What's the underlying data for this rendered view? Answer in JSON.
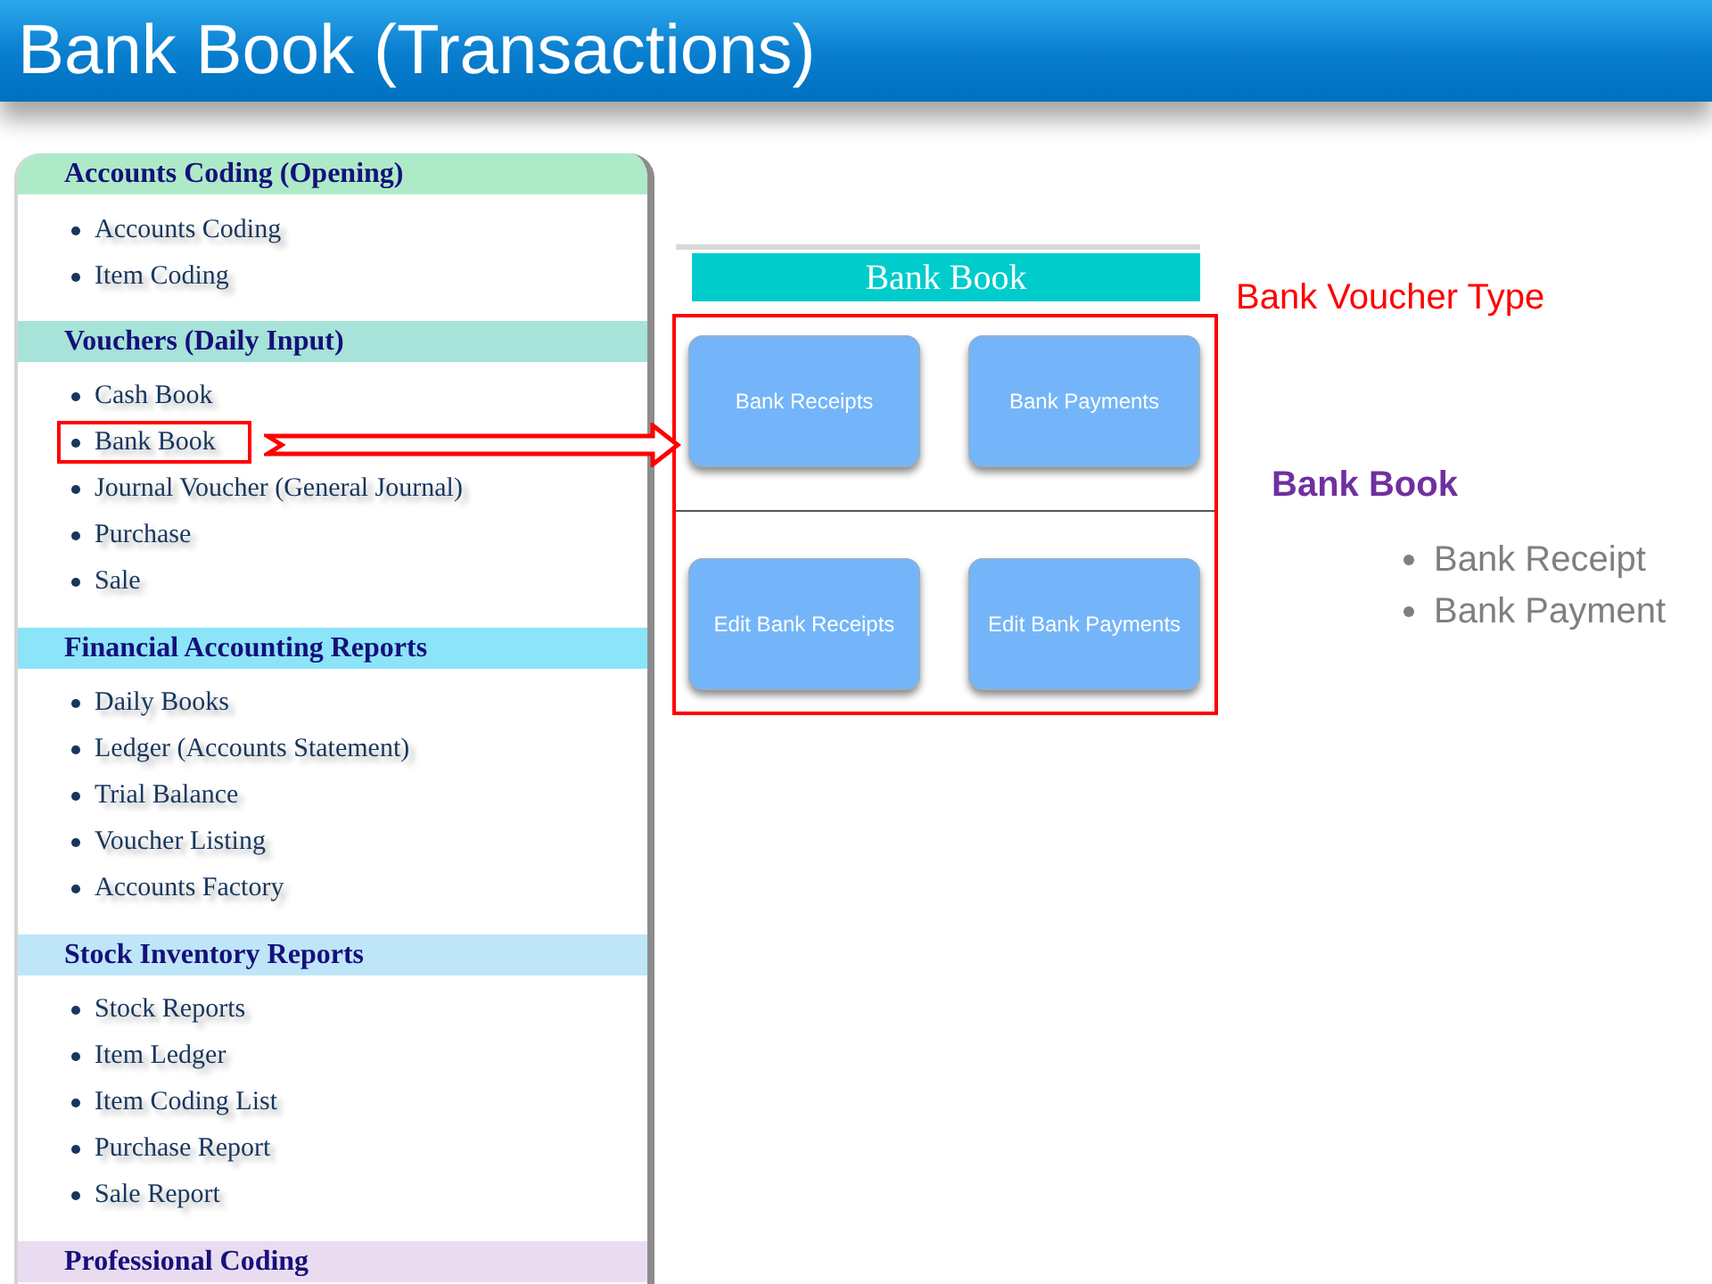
{
  "title": "Bank Book (Transactions)",
  "sidebar": {
    "sections": [
      {
        "heading": "Accounts Coding (Opening)",
        "color": "#aeeac8",
        "items": [
          {
            "label": "Accounts Coding",
            "highlighted": false
          },
          {
            "label": "Item Coding",
            "highlighted": false
          }
        ]
      },
      {
        "heading": "Vouchers (Daily Input)",
        "color": "#a6e3d8",
        "items": [
          {
            "label": "Cash Book",
            "highlighted": false
          },
          {
            "label": "Bank Book",
            "highlighted": true
          },
          {
            "label": "Journal Voucher (General Journal)",
            "highlighted": false
          },
          {
            "label": "Purchase",
            "highlighted": false
          },
          {
            "label": "Sale",
            "highlighted": false
          }
        ]
      },
      {
        "heading": "Financial Accounting Reports",
        "color": "#8be4f8",
        "items": [
          {
            "label": "Daily Books",
            "highlighted": false
          },
          {
            "label": "Ledger (Accounts Statement)",
            "highlighted": false
          },
          {
            "label": "Trial Balance",
            "highlighted": false
          },
          {
            "label": "Voucher Listing",
            "highlighted": false
          },
          {
            "label": "Accounts Factory",
            "highlighted": false
          }
        ]
      },
      {
        "heading": "Stock Inventory Reports",
        "color": "#bee6f8",
        "items": [
          {
            "label": "Stock Reports",
            "highlighted": false
          },
          {
            "label": "Item Ledger",
            "highlighted": false
          },
          {
            "label": "Item Coding List",
            "highlighted": false
          },
          {
            "label": "Purchase Report",
            "highlighted": false
          },
          {
            "label": "Sale Report",
            "highlighted": false
          }
        ]
      },
      {
        "heading": "Professional Coding",
        "color": "#eadcf0"
      }
    ]
  },
  "panel": {
    "heading": "Bank Book",
    "button_rows": [
      [
        "Bank Receipts",
        "Bank Payments"
      ],
      [
        "Edit Bank Receipts",
        "Edit Bank Payments"
      ]
    ]
  },
  "callout": {
    "label": "Bank Voucher Type"
  },
  "notes": {
    "heading": "Bank Book",
    "bullets": [
      "Bank Receipt",
      "Bank Payment"
    ]
  }
}
